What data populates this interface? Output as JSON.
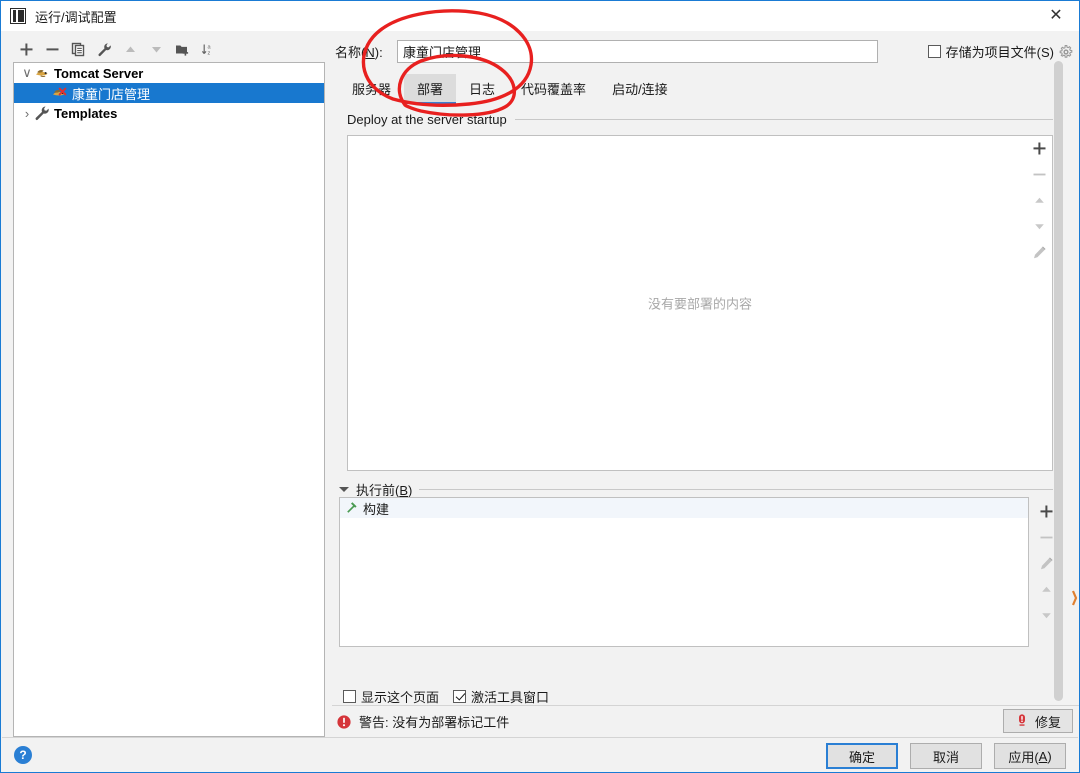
{
  "window": {
    "title": "运行/调试配置",
    "app_icon": "intellij-idea-icon",
    "close_label": "✕"
  },
  "toolbar": {
    "buttons": [
      {
        "name": "add-configuration-button",
        "icon": "plus-icon",
        "enabled": true
      },
      {
        "name": "remove-configuration-button",
        "icon": "minus-icon",
        "enabled": true
      },
      {
        "name": "copy-configuration-button",
        "icon": "copy-icon",
        "enabled": true
      },
      {
        "name": "edit-templates-button",
        "icon": "wrench-icon",
        "enabled": true
      },
      {
        "name": "move-up-button",
        "icon": "arrow-up-icon",
        "enabled": false
      },
      {
        "name": "move-down-button",
        "icon": "arrow-down-icon",
        "enabled": false
      },
      {
        "name": "create-folder-button",
        "icon": "folder-add-icon",
        "enabled": true
      },
      {
        "name": "sort-configurations-button",
        "icon": "sort-az-icon",
        "enabled": true
      }
    ]
  },
  "tree": {
    "nodes": [
      {
        "label": "Tomcat Server",
        "level": 0,
        "twisty": "∨",
        "icon": "tomcat-icon",
        "bold": true,
        "selected": false
      },
      {
        "label": "康童门店管理",
        "level": 1,
        "twisty": "",
        "icon": "tomcat-error-icon",
        "bold": false,
        "selected": true
      },
      {
        "label": "Templates",
        "level": 0,
        "twisty": "›",
        "icon": "wrench-icon",
        "bold": true,
        "selected": false
      }
    ]
  },
  "name_row": {
    "label_prefix": "名称(",
    "label_mnemonic": "N",
    "label_suffix": "):",
    "value": "康童门店管理",
    "placeholder": ""
  },
  "store_as_project_file": {
    "label": "存储为项目文件(S)",
    "checked": false,
    "gear_icon": "gear-icon"
  },
  "tabs": [
    {
      "label": "服务器",
      "active": false
    },
    {
      "label": "部署",
      "active": true
    },
    {
      "label": "日志",
      "active": false
    },
    {
      "label": "代码覆盖率",
      "active": false
    },
    {
      "label": "启动/连接",
      "active": false
    }
  ],
  "deploy_group": {
    "title": "Deploy at the server startup",
    "empty_text": "没有要部署的内容",
    "side_buttons": [
      {
        "name": "deploy-add-button",
        "icon": "plus-icon",
        "enabled": true
      },
      {
        "name": "deploy-remove-button",
        "icon": "minus-icon",
        "enabled": false
      },
      {
        "name": "deploy-move-up-button",
        "icon": "arrow-up-icon",
        "enabled": false
      },
      {
        "name": "deploy-move-down-button",
        "icon": "arrow-down-icon",
        "enabled": false
      },
      {
        "name": "deploy-edit-button",
        "icon": "pencil-icon",
        "enabled": false
      }
    ]
  },
  "before_launch": {
    "title_prefix": "执行前(",
    "title_mnemonic": "B",
    "title_suffix": ")",
    "tasks": [
      {
        "label": "构建",
        "icon": "build-hammer-icon"
      }
    ],
    "side_buttons": [
      {
        "name": "task-add-button",
        "icon": "plus-icon",
        "enabled": true
      },
      {
        "name": "task-remove-button",
        "icon": "minus-icon",
        "enabled": false
      },
      {
        "name": "task-edit-button",
        "icon": "pencil-icon",
        "enabled": false
      },
      {
        "name": "task-move-up-button",
        "icon": "arrow-up-icon",
        "enabled": false
      },
      {
        "name": "task-move-down-button",
        "icon": "arrow-down-icon",
        "enabled": false
      }
    ]
  },
  "bottom_options": [
    {
      "label": "显示这个页面",
      "checked": false,
      "name": "show-this-page-checkbox"
    },
    {
      "label": "激活工具窗口",
      "checked": true,
      "name": "activate-tool-window-checkbox"
    }
  ],
  "warning": {
    "icon": "error-exclamation-icon",
    "text": "警告: 没有为部署标记工件",
    "fix_button_label": "修复",
    "fix_button_icon": "error-exclamation-icon"
  },
  "footer": {
    "help_label": "?",
    "buttons": [
      {
        "label": "确定",
        "mnemonic": "",
        "default": true,
        "name": "ok-button"
      },
      {
        "label": "取消",
        "mnemonic": "",
        "default": false,
        "name": "cancel-button"
      },
      {
        "label": "应用(A)",
        "mnemonic": "A",
        "default": false,
        "name": "apply-button"
      }
    ]
  },
  "annotation": {
    "color": "#e8201f",
    "shape": "hand-drawn-circle-around-deploy-tab"
  },
  "colors": {
    "accent": "#2a7fd4",
    "selection": "#1878cf",
    "tab_active_bg": "#dcdcdc",
    "warning": "#d5353a",
    "annotation_red": "#e8201f"
  }
}
